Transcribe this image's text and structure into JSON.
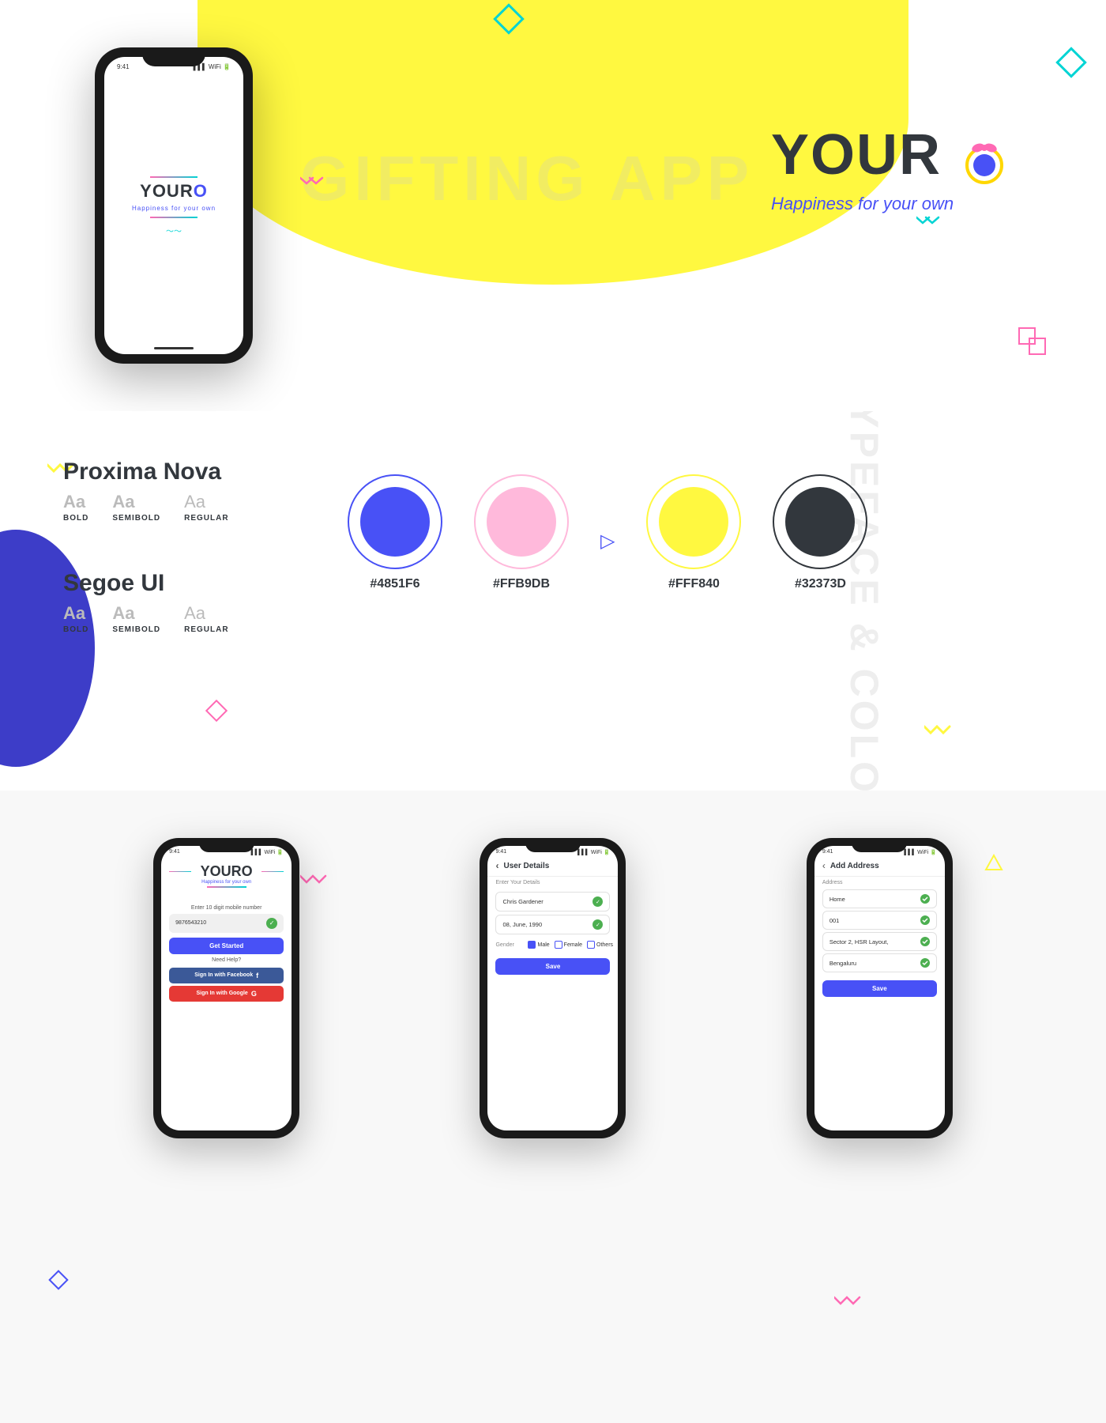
{
  "hero": {
    "gifting_app_text": "GIFTING APP",
    "brand_name": "YOUR",
    "brand_o": "O",
    "brand_tagline": "Happiness for your own",
    "phone": {
      "time": "9:41",
      "signal": "▌▌▌",
      "wifi": "WiFi",
      "battery": "🔋",
      "logo_text": "YOURO",
      "tagline": "Happiness for your own"
    }
  },
  "typeface": {
    "section_label": "TYPEFACE & COLOR",
    "fonts": [
      {
        "name": "Proxima Nova",
        "weights": [
          {
            "sample": "Aa",
            "label": "BOLD"
          },
          {
            "sample": "Aa",
            "label": "SEMIBOLD"
          },
          {
            "sample": "Aa",
            "label": "REGULAR"
          }
        ]
      },
      {
        "name": "Segoe UI",
        "weights": [
          {
            "sample": "Aa",
            "label": "BOLD"
          },
          {
            "sample": "Aa",
            "label": "SEMIBOLD"
          },
          {
            "sample": "Aa",
            "label": "REGULAR"
          }
        ]
      }
    ],
    "colors": [
      {
        "hex": "#4851F6",
        "outer_border": "#4851F6",
        "inner": "#4851F6"
      },
      {
        "hex": "#FFB9DB",
        "outer_border": "#FFB9DB",
        "inner": "#FFB9DB"
      },
      {
        "hex": "#FFF840",
        "outer_border": "#FFF840",
        "inner": "#FFF840"
      },
      {
        "hex": "#32373D",
        "outer_border": "#32373D",
        "inner": "#32373D"
      }
    ]
  },
  "screens": {
    "login": {
      "logo": "YOURO",
      "tagline": "Happiness for your own",
      "instruction": "Enter 10 digit mobile number",
      "phone_number": "9876543210",
      "get_started": "Get Started",
      "need_help": "Need Help?",
      "facebook_btn": "Sign In with Facebook",
      "google_btn": "Sign In with Google"
    },
    "user_details": {
      "title": "User Details",
      "subtitle": "Enter Your Details",
      "name": "Chris Gardener",
      "dob": "08, June, 1990",
      "gender_label": "Gender",
      "male": "Male",
      "female": "Female",
      "others": "Others",
      "save_btn": "Save"
    },
    "add_address": {
      "title": "Add Address",
      "address_label": "Address",
      "home": "Home",
      "pin": "001",
      "street": "Sector 2, HSR Layout,",
      "city": "Bengaluru",
      "save_btn": "Save"
    }
  },
  "decorations": {
    "chevron_color_yellow": "#FFF840",
    "chevron_color_pink": "#FF69B4",
    "chevron_color_cyan": "#00d4d4",
    "diamond_pink": "#FF69B4",
    "diamond_blue": "#4851F6",
    "triangle_blue": "#4851F6",
    "triangle_yellow": "#FFF840"
  }
}
